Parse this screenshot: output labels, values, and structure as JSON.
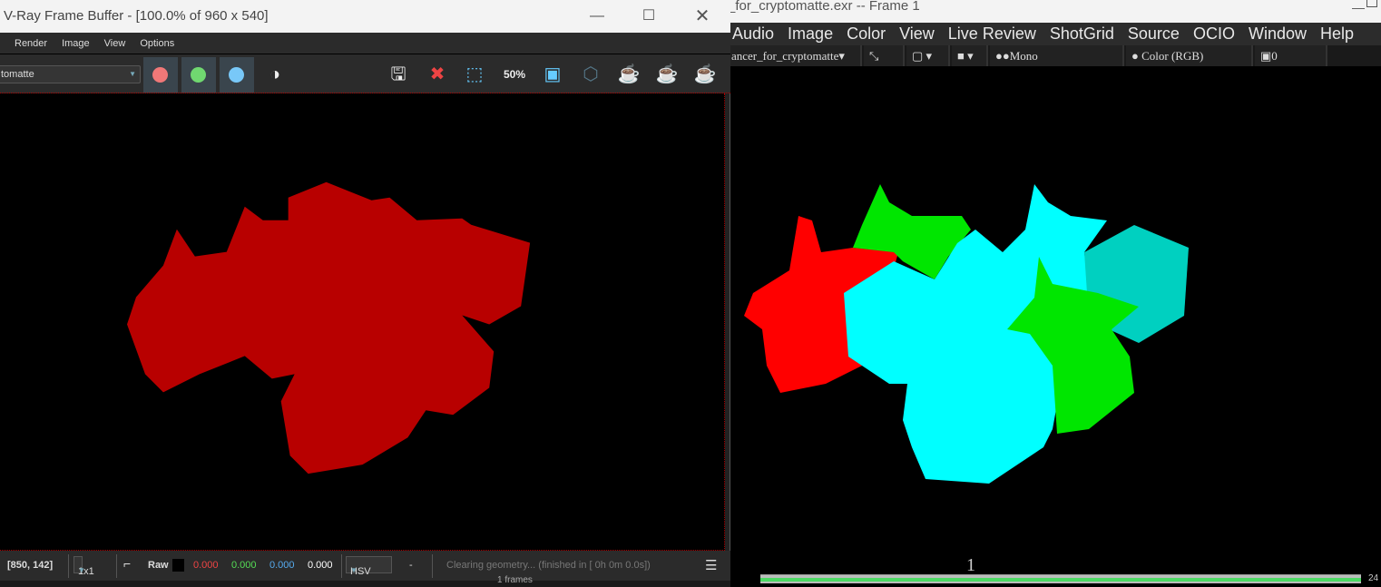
{
  "rv": {
    "title": "_for_cryptomatte.exr -- Frame 1",
    "menu": [
      "Audio",
      "Image",
      "Color",
      "View",
      "Live Review",
      "ShotGrid",
      "Source",
      "OCIO",
      "Window",
      "Help"
    ],
    "toolbar": {
      "source": "ancer_for_cryptomatte▾",
      "channel": "●●Mono",
      "color": "Color (RGB)",
      "monitor": "0"
    },
    "timeline": {
      "current_frame": "1",
      "end_frame": "24",
      "frames_label": "1 frames",
      "progress": 1.0
    }
  },
  "vfb": {
    "title": "V-Ray Frame Buffer - [100.0% of 960 x 540]",
    "menu": [
      "Render",
      "Image",
      "View",
      "Options"
    ],
    "channel_select": "tomatte",
    "channel_colors": {
      "red": "#f07878",
      "green": "#70d870",
      "blue": "#78c8f8"
    },
    "toolbar_zoom": "50%",
    "status": {
      "coords": "[850, 142]",
      "sampling": "1x1",
      "mode": "Raw",
      "r": "0.000",
      "g": "0.000",
      "b": "0.000",
      "a": "0.000",
      "colorspace": "HSV",
      "dash": "-",
      "message": "Clearing geometry... (finished in [ 0h  0m  0.0s])"
    }
  },
  "colors": {
    "red_mask": "#b80000",
    "rv_red": "#ff0000",
    "rv_green": "#00e600",
    "rv_cyan": "#00ffff",
    "rv_teal": "#00d0c0"
  }
}
